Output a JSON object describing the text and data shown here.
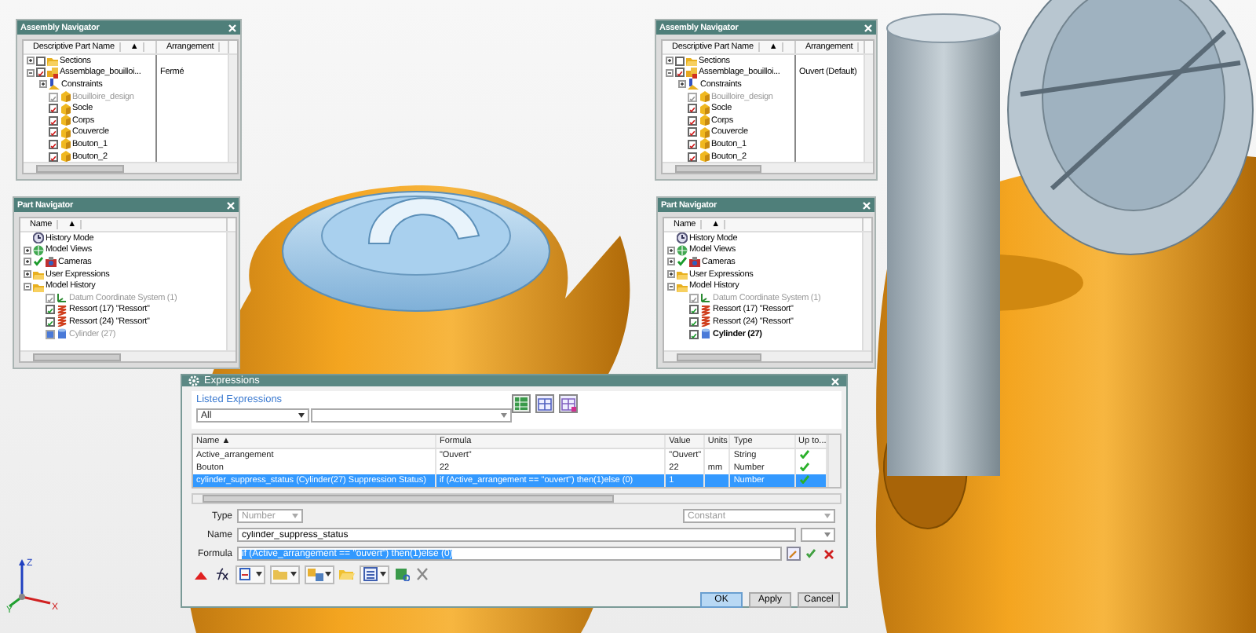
{
  "assembly_navigators": [
    {
      "title": "Assembly Navigator",
      "columns": [
        {
          "label": "Descriptive Part Name",
          "sort": "▲"
        },
        {
          "label": "Arrangement"
        }
      ],
      "items": [
        {
          "label": "Sections",
          "kind": "folder",
          "expanded": false,
          "checked": false,
          "disabled": false
        },
        {
          "label": "Assemblage_bouilloi...",
          "kind": "assembly",
          "expanded": true,
          "checked": true,
          "disabled": false,
          "arrangement": "Fermé",
          "children": [
            {
              "label": "Constraints",
              "kind": "constraints",
              "expanded": false
            },
            {
              "label": "Bouilloire_design",
              "kind": "part",
              "checked": true,
              "disabled": true
            },
            {
              "label": "Socle",
              "kind": "part",
              "checked": true,
              "disabled": false
            },
            {
              "label": "Corps",
              "kind": "part",
              "checked": true,
              "disabled": false
            },
            {
              "label": "Couvercle",
              "kind": "part",
              "checked": true,
              "disabled": false
            },
            {
              "label": "Bouton_1",
              "kind": "part",
              "checked": true,
              "disabled": false
            },
            {
              "label": "Bouton_2",
              "kind": "part",
              "checked": true,
              "disabled": false
            }
          ]
        }
      ]
    },
    {
      "title": "Assembly Navigator",
      "columns": [
        {
          "label": "Descriptive Part Name",
          "sort": "▲"
        },
        {
          "label": "Arrangement"
        }
      ],
      "items": [
        {
          "label": "Sections",
          "kind": "folder",
          "expanded": false,
          "checked": false,
          "disabled": false
        },
        {
          "label": "Assemblage_bouilloi...",
          "kind": "assembly",
          "expanded": true,
          "checked": true,
          "disabled": false,
          "arrangement": "Ouvert (Default)",
          "children": [
            {
              "label": "Constraints",
              "kind": "constraints",
              "expanded": false
            },
            {
              "label": "Bouilloire_design",
              "kind": "part",
              "checked": true,
              "disabled": true
            },
            {
              "label": "Socle",
              "kind": "part",
              "checked": true,
              "disabled": false
            },
            {
              "label": "Corps",
              "kind": "part",
              "checked": true,
              "disabled": false
            },
            {
              "label": "Couvercle",
              "kind": "part",
              "checked": true,
              "disabled": false
            },
            {
              "label": "Bouton_1",
              "kind": "part",
              "checked": true,
              "disabled": false
            },
            {
              "label": "Bouton_2",
              "kind": "part",
              "checked": true,
              "disabled": false
            }
          ]
        }
      ]
    }
  ],
  "part_navigators": [
    {
      "title": "Part Navigator",
      "columns": [
        {
          "label": "Name",
          "sort": "▲"
        }
      ],
      "items": [
        {
          "label": "History Mode",
          "kind": "history"
        },
        {
          "label": "Model Views",
          "kind": "views",
          "expanded": false
        },
        {
          "label": "Cameras",
          "kind": "cameras",
          "expanded": false,
          "visible": true
        },
        {
          "label": "User Expressions",
          "kind": "folder",
          "expanded": false
        },
        {
          "label": "Model History",
          "kind": "folder",
          "expanded": true,
          "children": [
            {
              "label": "Datum Coordinate System (1)",
              "kind": "datum",
              "checked": true,
              "disabled": true,
              "current": false
            },
            {
              "label": "Ressort (17) \"Ressort\"",
              "kind": "spring",
              "checked": true,
              "disabled": false,
              "current": false
            },
            {
              "label": "Ressort (24) \"Ressort\"",
              "kind": "spring",
              "checked": true,
              "disabled": false,
              "current": false
            },
            {
              "label": "Cylinder (27)",
              "kind": "cylinder",
              "checked": false,
              "disabled": true,
              "current": false
            }
          ]
        }
      ]
    },
    {
      "title": "Part Navigator",
      "columns": [
        {
          "label": "Name",
          "sort": "▲"
        }
      ],
      "items": [
        {
          "label": "History Mode",
          "kind": "history"
        },
        {
          "label": "Model Views",
          "kind": "views",
          "expanded": false
        },
        {
          "label": "Cameras",
          "kind": "cameras",
          "expanded": false,
          "visible": true
        },
        {
          "label": "User Expressions",
          "kind": "folder",
          "expanded": false
        },
        {
          "label": "Model History",
          "kind": "folder",
          "expanded": true,
          "children": [
            {
              "label": "Datum Coordinate System (1)",
              "kind": "datum",
              "checked": true,
              "disabled": true,
              "current": false
            },
            {
              "label": "Ressort (17) \"Ressort\"",
              "kind": "spring",
              "checked": true,
              "disabled": false,
              "current": false
            },
            {
              "label": "Ressort (24) \"Ressort\"",
              "kind": "spring",
              "checked": true,
              "disabled": false,
              "current": false
            },
            {
              "label": "Cylinder (27)",
              "kind": "cylinder",
              "checked": true,
              "disabled": false,
              "current": true
            }
          ]
        }
      ]
    }
  ],
  "expressions": {
    "title": "Expressions",
    "section": "Listed Expressions",
    "filter": {
      "value": "All"
    },
    "columns": [
      {
        "label": "Name",
        "sort": "▲"
      },
      {
        "label": "Formula"
      },
      {
        "label": "Value"
      },
      {
        "label": "Units"
      },
      {
        "label": "Type"
      },
      {
        "label": "Up to..."
      }
    ],
    "rows": [
      {
        "name": "Active_arrangement",
        "formula": "\"Ouvert\"",
        "value": "\"Ouvert\"",
        "type": "String",
        "up_to_date": true,
        "selected": false
      },
      {
        "name": "Bouton",
        "formula": "22",
        "value": "22",
        "units": "mm",
        "type": "Number",
        "up_to_date": true,
        "selected": false
      },
      {
        "name": "cylinder_suppress_status  (Cylinder(27) Suppression Status)",
        "formula": "if (Active_arrangement == \"ouvert\") then(1)else (0)",
        "value": "1",
        "type": "Number",
        "up_to_date": true,
        "selected": true
      }
    ],
    "type_field": {
      "label": "Type",
      "value": "Number",
      "disabled": true
    },
    "mode_field": {
      "value": "Constant",
      "disabled": true
    },
    "name_field": {
      "label": "Name",
      "value": "cylinder_suppress_status"
    },
    "formula_field": {
      "label": "Formula",
      "value": "if (Active_arrangement == \"ouvert\") then(1)else (0)",
      "text_selected": true
    },
    "buttons": [
      {
        "label": "OK",
        "default": true
      },
      {
        "label": "Apply",
        "default": false
      },
      {
        "label": "Cancel",
        "default": false
      }
    ]
  },
  "axis_triad": {
    "labels": [
      "Z",
      "X",
      "Y"
    ]
  }
}
